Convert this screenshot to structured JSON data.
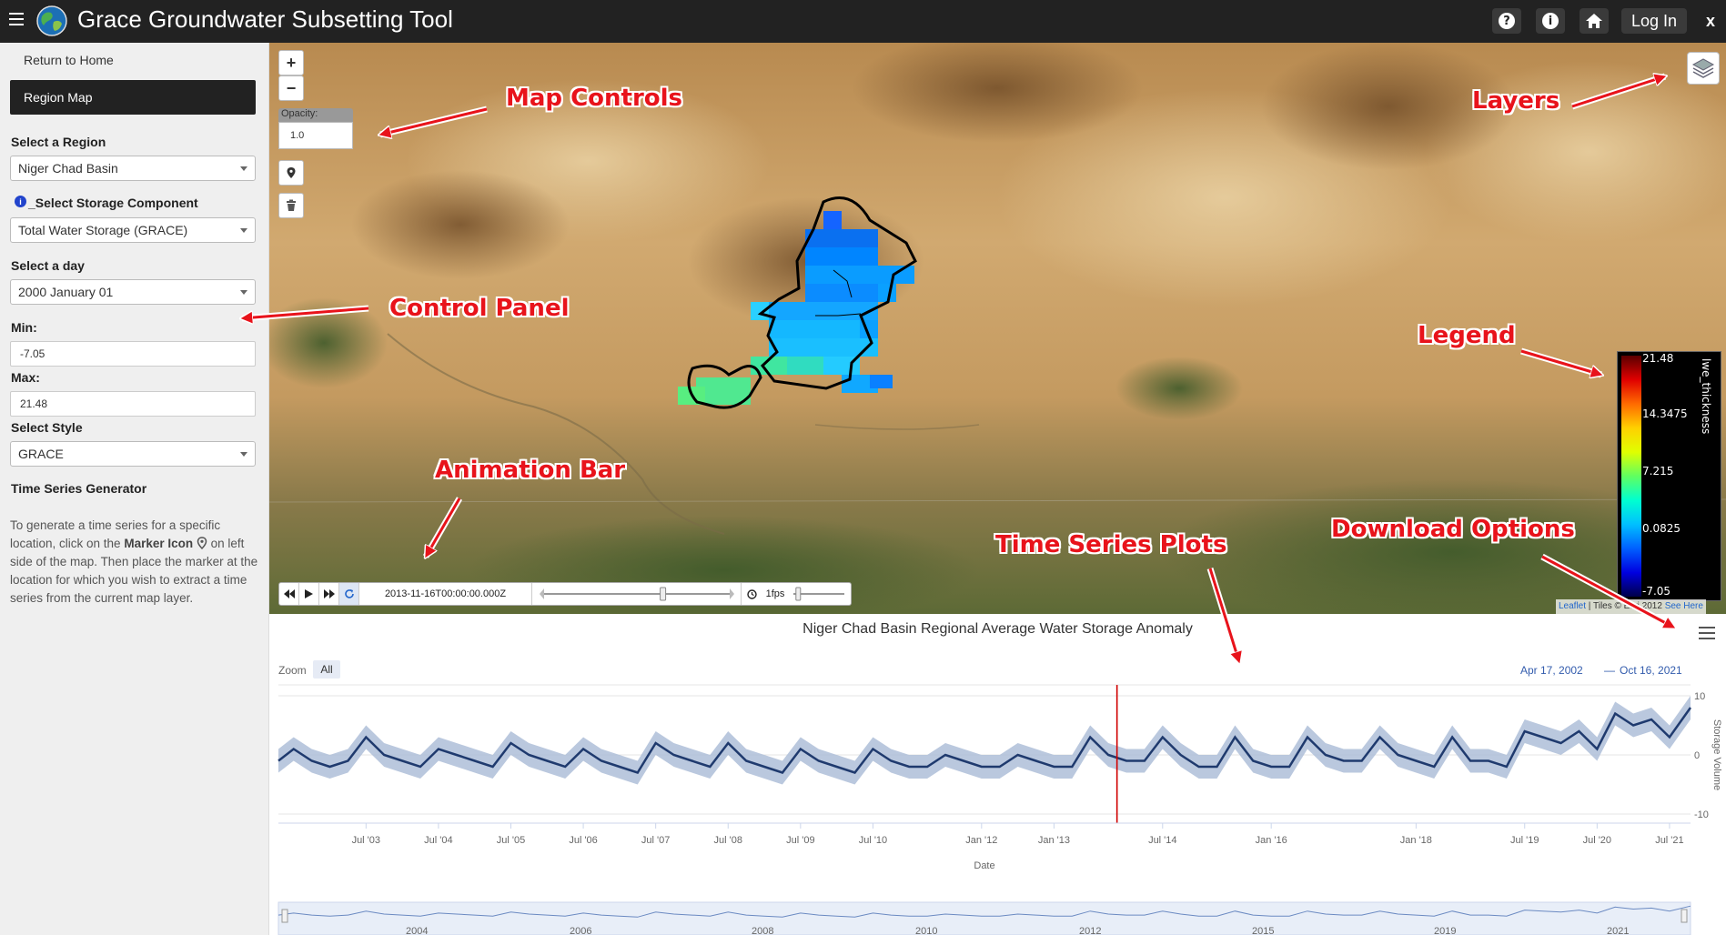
{
  "header": {
    "title": "Grace Groundwater Subsetting Tool",
    "help_icon": "question-icon",
    "info_icon": "info-icon",
    "home_icon": "home-icon",
    "login_label": "Log In",
    "close_label": "x"
  },
  "sidebar": {
    "return_home": "Return to Home",
    "region_map": "Region Map",
    "region_label": "Select a Region",
    "region_value": "Niger Chad Basin",
    "storage_label": "_Select Storage Component",
    "storage_value": "Total Water Storage (GRACE)",
    "day_label": "Select a day",
    "day_value": "2000 January 01",
    "min_label": "Min:",
    "min_value": "-7.05",
    "max_label": "Max:",
    "max_value": "21.48",
    "style_label": "Select Style",
    "style_value": "GRACE",
    "ts_heading": "Time Series Generator",
    "ts_text_1": "To generate a time series for a specific location, click on the ",
    "ts_marker": "Marker Icon",
    "ts_text_2": " on left side of the map. Then place the marker at the location for which you wish to extract a time series from the current map layer."
  },
  "map": {
    "zoom_in": "+",
    "zoom_out": "−",
    "opacity_label": "Opacity:",
    "opacity_value": "1.0",
    "marker_icon": "map-marker-icon",
    "trash_icon": "trash-icon",
    "layers_icon": "layers-icon",
    "animation": {
      "timestamp": "2013-11-16T00:00:00.000Z",
      "fps": "1fps",
      "slider_position": 0.64,
      "fps_position": 0.05
    },
    "legend": {
      "title": "lwe_thickness",
      "values": [
        "21.48",
        "14.3475",
        "7.215",
        "0.0825",
        "-7.05"
      ]
    },
    "attribution": {
      "leaflet": "Leaflet",
      "tiles": " | Tiles © Esri 2012 ",
      "see_here": "See Here"
    }
  },
  "annotations": {
    "map_controls": "Map Controls",
    "layers": "Layers",
    "control_panel": "Control Panel",
    "legend": "Legend",
    "animation_bar": "Animation Bar",
    "time_series": "Time Series Plots",
    "download": "Download Options"
  },
  "colors": {
    "annotation": "#e8131b",
    "series_line": "#1f3a6e",
    "band": "#a9bad6",
    "marker_line": "#d00000"
  },
  "chart_data": {
    "type": "line",
    "title": "Niger Chad Basin Regional Average Water Storage Anomaly",
    "xlabel": "Date",
    "ylabel": "Storage Volume",
    "zoom_label": "Zoom",
    "zoom_all": "All",
    "range_from": "Apr 17, 2002",
    "range_sep": "—",
    "range_to": "Oct 16, 2021",
    "ylim": [
      -10,
      10
    ],
    "xlim": [
      2002.29,
      2021.79
    ],
    "yticks": [
      10,
      0,
      -10
    ],
    "xticks": [
      {
        "label": "Jul '03",
        "x": 2003.5
      },
      {
        "label": "Jul '04",
        "x": 2004.5
      },
      {
        "label": "Jul '05",
        "x": 2005.5
      },
      {
        "label": "Jul '06",
        "x": 2006.5
      },
      {
        "label": "Jul '07",
        "x": 2007.5
      },
      {
        "label": "Jul '08",
        "x": 2008.5
      },
      {
        "label": "Jul '09",
        "x": 2009.5
      },
      {
        "label": "Jul '10",
        "x": 2010.5
      },
      {
        "label": "Jan '12",
        "x": 2012.0
      },
      {
        "label": "Jan '13",
        "x": 2013.0
      },
      {
        "label": "Jul '14",
        "x": 2014.5
      },
      {
        "label": "Jan '16",
        "x": 2016.0
      },
      {
        "label": "Jan '18",
        "x": 2018.0
      },
      {
        "label": "Jul '19",
        "x": 2019.5
      },
      {
        "label": "Jul '20",
        "x": 2020.5
      },
      {
        "label": "Jul '21",
        "x": 2021.5
      }
    ],
    "navigator_years": [
      "2004",
      "2006",
      "2008",
      "2010",
      "2012",
      "2015",
      "2019",
      "2021"
    ],
    "current_date": 2013.87,
    "series": [
      {
        "x": [
          2002.29,
          2002.5,
          2002.75,
          2003.0,
          2003.25,
          2003.5,
          2003.75,
          2004.0,
          2004.25,
          2004.5,
          2004.75,
          2005.0,
          2005.25,
          2005.5,
          2005.75,
          2006.0,
          2006.25,
          2006.5,
          2006.75,
          2007.0,
          2007.25,
          2007.5,
          2007.75,
          2008.0,
          2008.25,
          2008.5,
          2008.75,
          2009.0,
          2009.25,
          2009.5,
          2009.75,
          2010.0,
          2010.25,
          2010.5,
          2010.75,
          2011.0,
          2011.25,
          2011.5,
          2011.75,
          2012.0,
          2012.25,
          2012.5,
          2012.75,
          2013.0,
          2013.25,
          2013.5,
          2013.75,
          2014.0,
          2014.25,
          2014.5,
          2014.75,
          2015.0,
          2015.25,
          2015.5,
          2015.75,
          2016.0,
          2016.25,
          2016.5,
          2016.75,
          2017.0,
          2017.25,
          2017.5,
          2017.75,
          2018.0,
          2018.25,
          2018.5,
          2018.75,
          2019.0,
          2019.25,
          2019.5,
          2019.75,
          2020.0,
          2020.25,
          2020.5,
          2020.75,
          2021.0,
          2021.25,
          2021.5,
          2021.79
        ],
        "values": [
          -1,
          1,
          -1,
          -2,
          -1,
          3,
          0,
          -1,
          -2,
          1,
          0,
          -1,
          -2,
          2,
          0,
          -1,
          -2,
          1,
          -1,
          -2,
          -3,
          2,
          0,
          -1,
          -2,
          2,
          -1,
          -2,
          -3,
          1,
          -1,
          -2,
          -3,
          1,
          -1,
          -2,
          -2,
          0,
          -1,
          -2,
          -2,
          0,
          -1,
          -2,
          -2,
          3,
          0,
          -1,
          -1,
          3,
          0,
          -2,
          -2,
          3,
          -1,
          -2,
          -2,
          3,
          0,
          -1,
          -1,
          3,
          0,
          -1,
          -2,
          3,
          -1,
          -1,
          -2,
          4,
          3,
          2,
          4,
          1,
          7,
          5,
          6,
          3,
          8
        ]
      }
    ]
  }
}
